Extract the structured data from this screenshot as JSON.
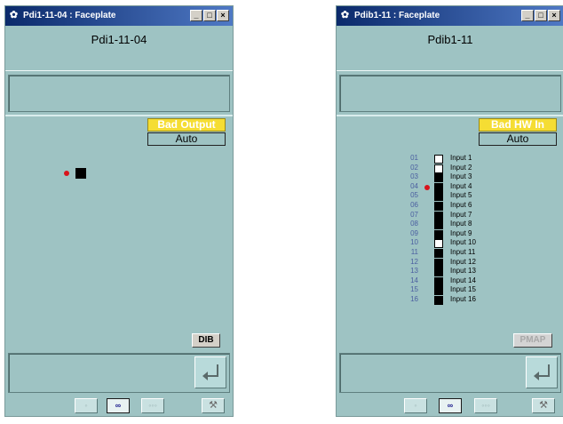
{
  "faceplate1": {
    "title": "Pdi1-11-04 : Faceplate",
    "tag": "Pdi1-11-04",
    "alarm": "Bad Output",
    "mode": "Auto",
    "dib_label": "DIB",
    "dot_color": "#d8141c",
    "indicator_color": "#000000"
  },
  "faceplate2": {
    "title": "Pdib1-11 : Faceplate",
    "tag": "Pdib1-11",
    "alarm": "Bad HW In",
    "mode": "Auto",
    "pmap_label": "PMAP",
    "dot_color": "#d8141c",
    "inputs": [
      {
        "num": "01",
        "label": "Input 1",
        "state": "off"
      },
      {
        "num": "02",
        "label": "Input 2",
        "state": "off"
      },
      {
        "num": "03",
        "label": "Input 3",
        "state": "on"
      },
      {
        "num": "04",
        "label": "Input 4",
        "state": "on"
      },
      {
        "num": "05",
        "label": "Input 5",
        "state": "on"
      },
      {
        "num": "06",
        "label": "Input 6",
        "state": "on"
      },
      {
        "num": "07",
        "label": "Input 7",
        "state": "on"
      },
      {
        "num": "08",
        "label": "Input 8",
        "state": "on"
      },
      {
        "num": "09",
        "label": "Input 9",
        "state": "on"
      },
      {
        "num": "10",
        "label": "Input 10",
        "state": "off"
      },
      {
        "num": "11",
        "label": "Input 11",
        "state": "on"
      },
      {
        "num": "12",
        "label": "Input 12",
        "state": "on"
      },
      {
        "num": "13",
        "label": "Input 13",
        "state": "on"
      },
      {
        "num": "14",
        "label": "Input 14",
        "state": "on"
      },
      {
        "num": "15",
        "label": "Input 15",
        "state": "on"
      },
      {
        "num": "16",
        "label": "Input 16",
        "state": "on"
      }
    ],
    "selected_input": "04"
  },
  "window_buttons": {
    "minimize": "_",
    "maximize": "□",
    "close": "×"
  },
  "navbar": {
    "prev": "◦",
    "link": "∞",
    "next": "◦◦◦",
    "wrench": "⚒"
  },
  "colors": {
    "panel": "#9ec3c3",
    "title_from": "#0b2a6b",
    "title_to": "#4f79c5",
    "alarm": "#f5dd33"
  }
}
